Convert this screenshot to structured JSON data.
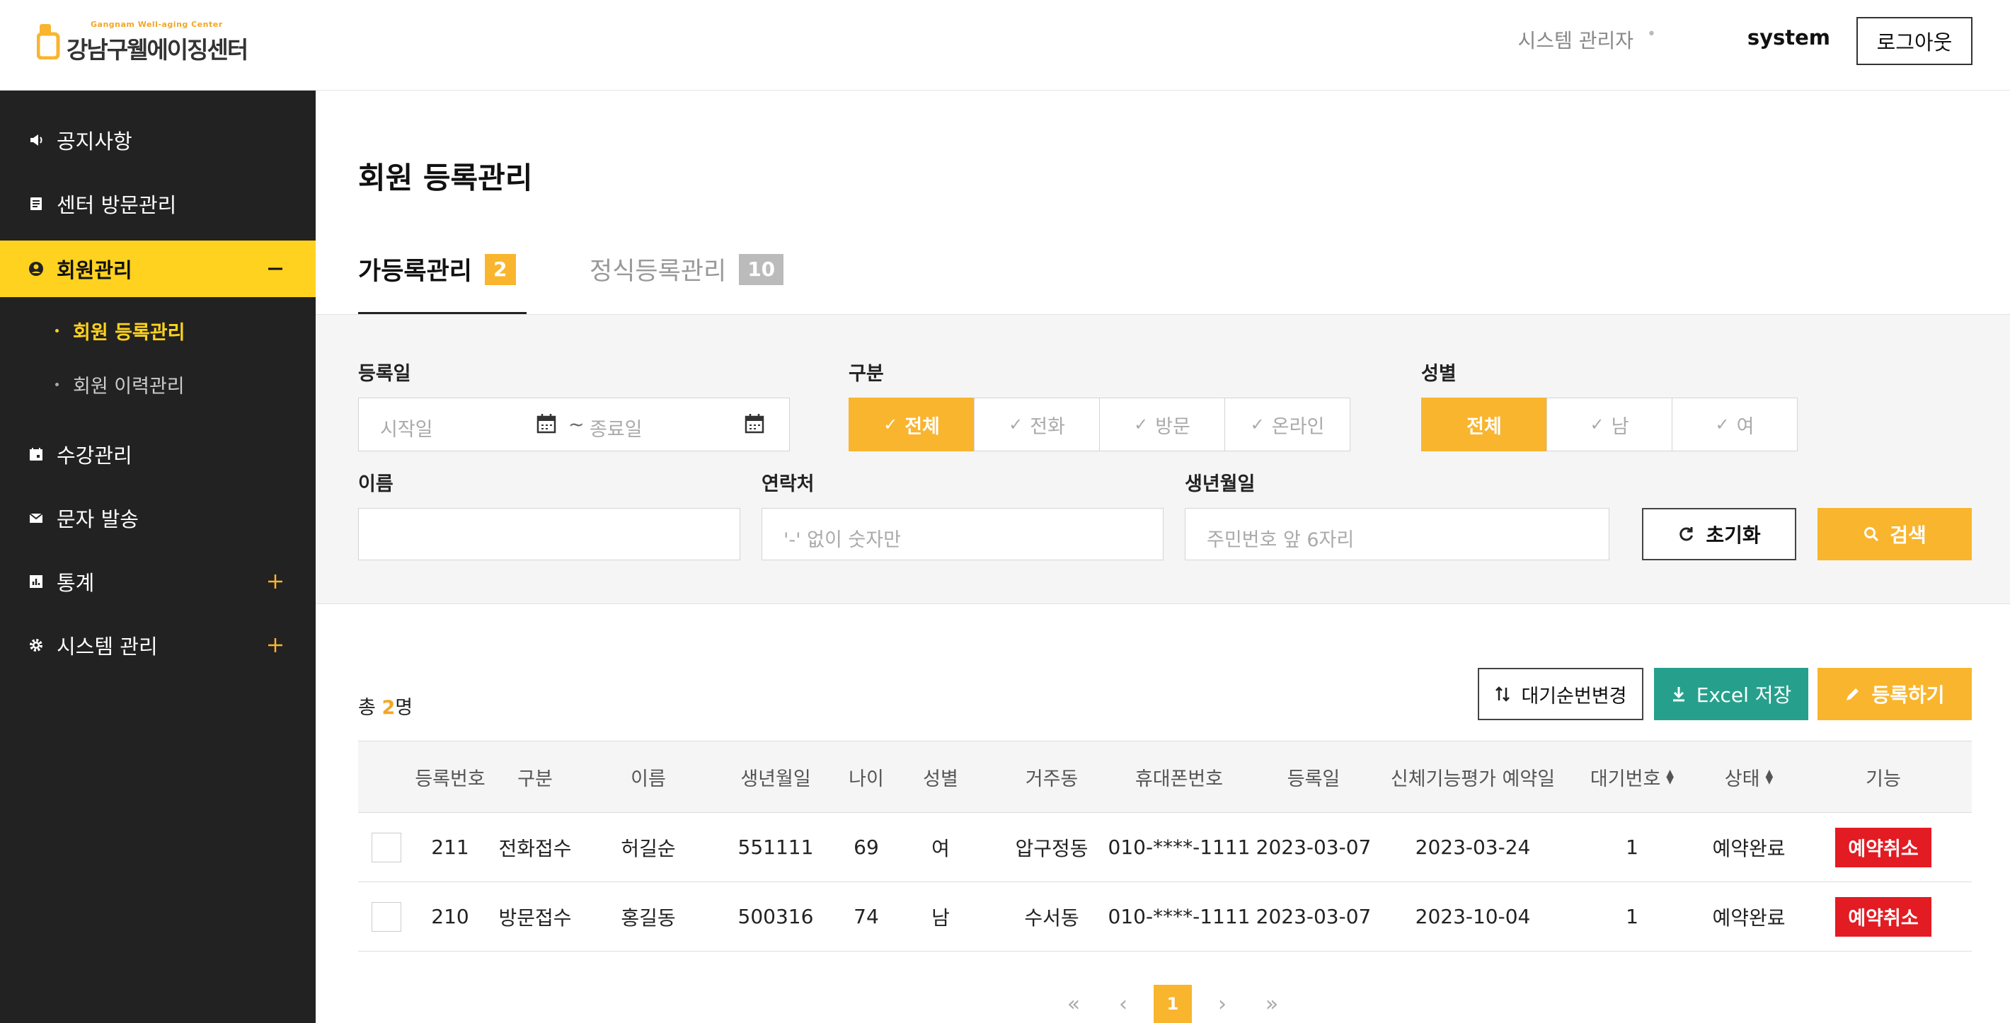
{
  "header": {
    "logo_sub": "Gangnam Well-aging Center",
    "logo_main": "강남구웰에이징센터",
    "user_role": "시스템 관리자",
    "user_name": "system",
    "logout_label": "로그아웃"
  },
  "sidebar": {
    "items": [
      {
        "label": "공지사항",
        "icon": "megaphone-icon"
      },
      {
        "label": "센터 방문관리",
        "icon": "document-icon"
      },
      {
        "label": "회원관리",
        "icon": "user-circle-icon",
        "active": true,
        "toggle": "minus-icon"
      },
      {
        "label": "수강관리",
        "icon": "calendar-icon"
      },
      {
        "label": "문자 발송",
        "icon": "mail-icon"
      },
      {
        "label": "통계",
        "icon": "chart-icon",
        "toggle": "plus-icon"
      },
      {
        "label": "시스템 관리",
        "icon": "gear-icon",
        "toggle": "plus-icon"
      }
    ],
    "sub_items": [
      {
        "label": "회원 등록관리",
        "active": true
      },
      {
        "label": "회원 이력관리"
      }
    ]
  },
  "page": {
    "title": "회원 등록관리"
  },
  "tabs": [
    {
      "label": "가등록관리",
      "badge": "2",
      "active": true
    },
    {
      "label": "정식등록관리",
      "badge": "10"
    }
  ],
  "filters": {
    "reg_date_label": "등록일",
    "start_placeholder": "시작일",
    "tilde": "~",
    "end_placeholder": "종료일",
    "type_label": "구분",
    "type_options": [
      "전체",
      "전화",
      "방문",
      "온라인"
    ],
    "gender_label": "성별",
    "gender_options": [
      "전체",
      "남",
      "여"
    ],
    "name_label": "이름",
    "name_value": "",
    "contact_label": "연락처",
    "contact_placeholder": "'-' 없이 숫자만",
    "birth_label": "생년월일",
    "birth_placeholder": "주민번호 앞 6자리",
    "reset_label": "초기화",
    "search_label": "검색"
  },
  "list": {
    "total_prefix": "총",
    "total_count": "2",
    "total_suffix": "명",
    "wait_change_label": "대기순번변경",
    "excel_label": "Excel 저장",
    "register_label": "등록하기"
  },
  "table": {
    "columns": [
      "등록번호",
      "구분",
      "이름",
      "생년월일",
      "나이",
      "성별",
      "거주동",
      "휴대폰번호",
      "등록일",
      "신체기능평가 예약일",
      "대기번호",
      "상태",
      "기능"
    ],
    "rows": [
      {
        "no": "211",
        "type": "전화접수",
        "name": "허길순",
        "birth": "551111",
        "age": "69",
        "gender": "여",
        "dong": "압구정동",
        "phone": "010-****-1111",
        "reg_date": "2023-03-07",
        "eval_date": "2023-03-24",
        "wait_no": "1",
        "status": "예약완료",
        "action": "예약취소"
      },
      {
        "no": "210",
        "type": "방문접수",
        "name": "홍길동",
        "birth": "500316",
        "age": "74",
        "gender": "남",
        "dong": "수서동",
        "phone": "010-****-1111",
        "reg_date": "2023-03-07",
        "eval_date": "2023-10-04",
        "wait_no": "1",
        "status": "예약완료",
        "action": "예약취소"
      }
    ]
  },
  "pagination": {
    "first": "«",
    "prev": "‹",
    "current": "1",
    "next": "›",
    "last": "»"
  },
  "colors": {
    "accent": "#f9b52e",
    "menu_active": "#ffd21f",
    "sidebar_bg": "#222222",
    "excel": "#26a08c",
    "danger": "#e31b23"
  }
}
